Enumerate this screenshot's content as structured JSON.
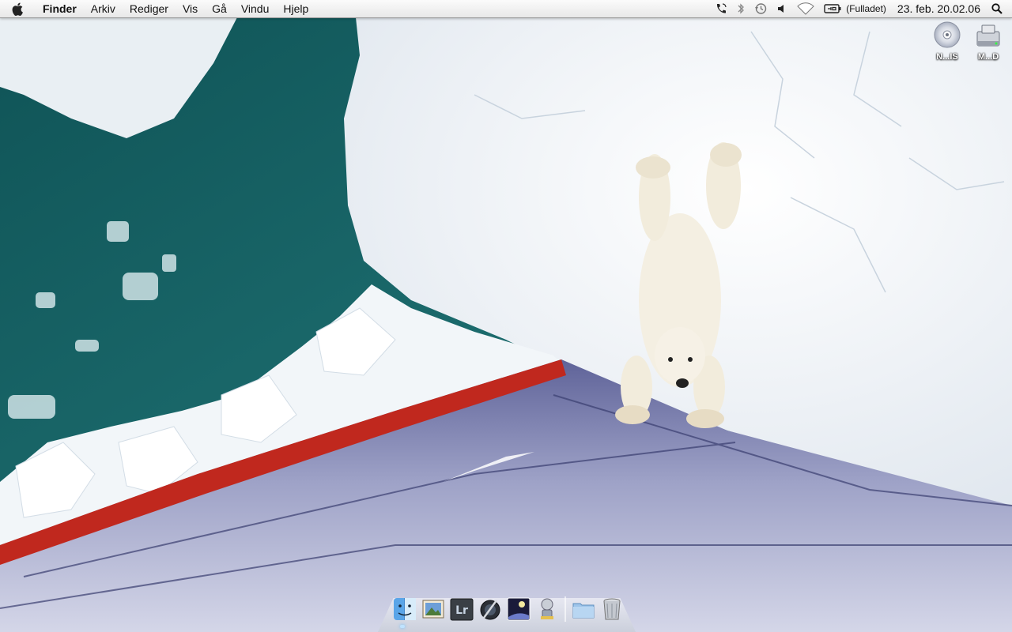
{
  "menubar": {
    "app_name": "Finder",
    "menus": [
      "Arkiv",
      "Rediger",
      "Vis",
      "Gå",
      "Vindu",
      "Hjelp"
    ],
    "status_icons": [
      "phone-icon",
      "bluetooth-icon",
      "time-machine-icon",
      "volume-icon",
      "wifi-icon",
      "battery-icon"
    ],
    "battery_label": "(Fulladet)",
    "clock": "23. feb.  20.02.06"
  },
  "desktop": {
    "icons": [
      {
        "label": "N...IS",
        "icon": "dvd-disc-icon"
      },
      {
        "label": "M...D",
        "icon": "hard-drive-icon"
      }
    ],
    "wallpaper": "polar-bear-on-ice-beside-ship-bow"
  },
  "dock": {
    "apps": [
      {
        "name": "Finder",
        "icon": "finder-icon",
        "running": true
      },
      {
        "name": "Preview",
        "icon": "preview-icon",
        "running": false
      },
      {
        "name": "Lr",
        "icon": "lightroom-icon",
        "running": false
      },
      {
        "name": "Aperture",
        "icon": "aperture-icon",
        "running": false
      },
      {
        "name": "iPhoto",
        "icon": "iphoto-icon",
        "running": false
      },
      {
        "name": "Automator",
        "icon": "automator-icon",
        "running": false
      }
    ],
    "folders": [
      {
        "name": "Documents",
        "icon": "folder-stack-icon"
      },
      {
        "name": "Trash",
        "icon": "trash-icon"
      }
    ]
  },
  "colors": {
    "menubar_bg": "#eeeeee",
    "sea": "#135a5e",
    "ice": "#f4f6fa",
    "hull_red": "#c0281e",
    "deck": "#8a8fb8"
  }
}
